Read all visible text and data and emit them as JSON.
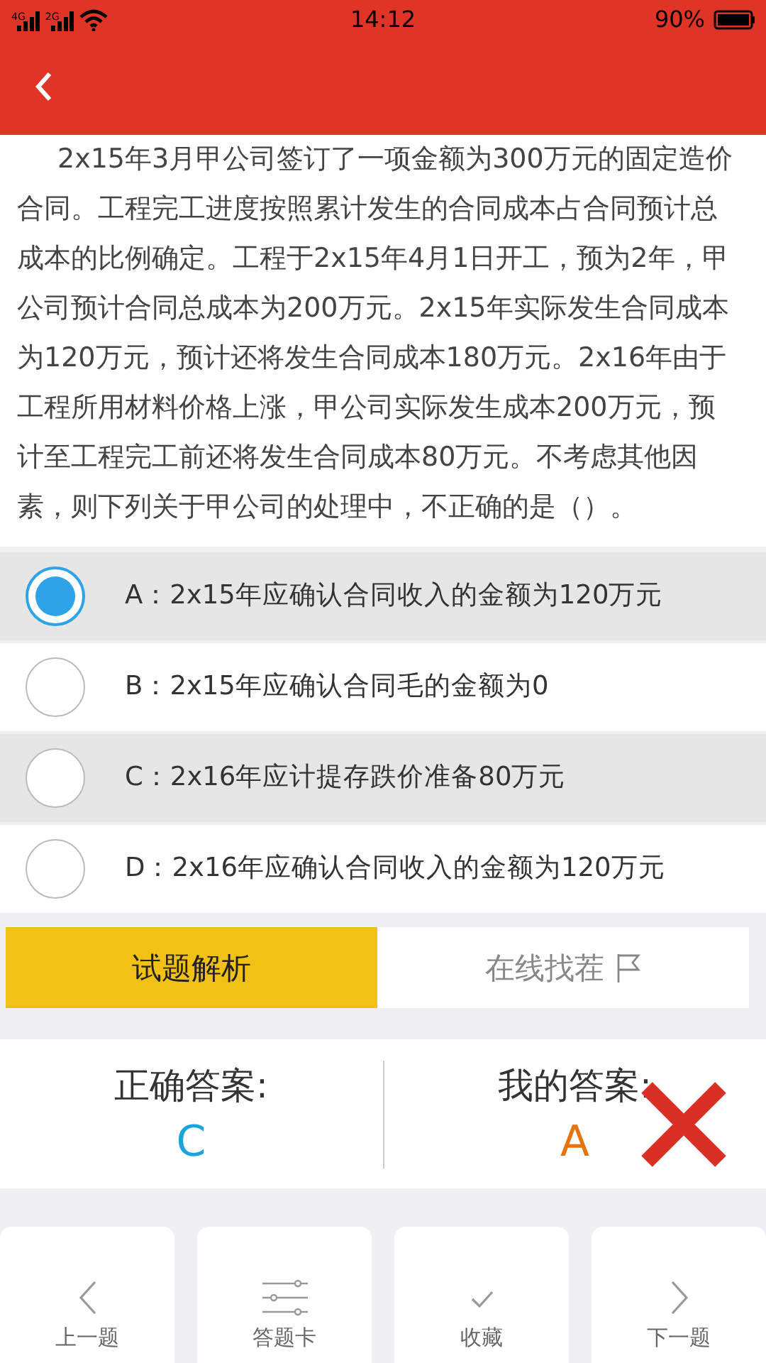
{
  "status_bar": {
    "networks": [
      "4G",
      "2G"
    ],
    "time": "14:12",
    "battery_text": "90%"
  },
  "question": "2x15年3月甲公司签订了一项金额为300万元的固定造价合同。工程完工进度按照累计发生的合同成本占合同预计总成本的比例确定。工程于2x15年4月1日开工，预为2年，甲公司预计合同总成本为200万元。2x15年实际发生合同成本为120万元，预计还将发生合同成本180万元。2x16年由于工程所用材料价格上涨，甲公司实际发生成本200万元，预计至工程完工前还将发生合同成本80万元。不考虑其他因素，则下列关于甲公司的处理中，不正确的是（）。",
  "options": [
    {
      "text": "A：2x15年应确认合同收入的金额为120万元",
      "selected": true,
      "correct": false
    },
    {
      "text": "B：2x15年应确认合同毛的金额为0",
      "selected": false,
      "correct": false
    },
    {
      "text": "C：2x16年应计提存跌价准备80万元",
      "selected": false,
      "correct": true
    },
    {
      "text": "D：2x16年应确认合同收入的金额为120万元",
      "selected": false,
      "correct": false
    }
  ],
  "tabs": [
    {
      "label": "试题解析",
      "selected": true
    },
    {
      "label": "在线找茬",
      "selected": false
    }
  ],
  "answers": {
    "correct_label": "正确答案:",
    "correct_value": "C",
    "my_label": "我的答案:",
    "my_value": "A",
    "is_right": false
  },
  "bottom_nav": [
    {
      "label": "上一题",
      "kind": "prev"
    },
    {
      "label": "答题卡",
      "kind": "card"
    },
    {
      "label": "收藏",
      "kind": "check"
    },
    {
      "label": "下一题",
      "kind": "next"
    }
  ]
}
